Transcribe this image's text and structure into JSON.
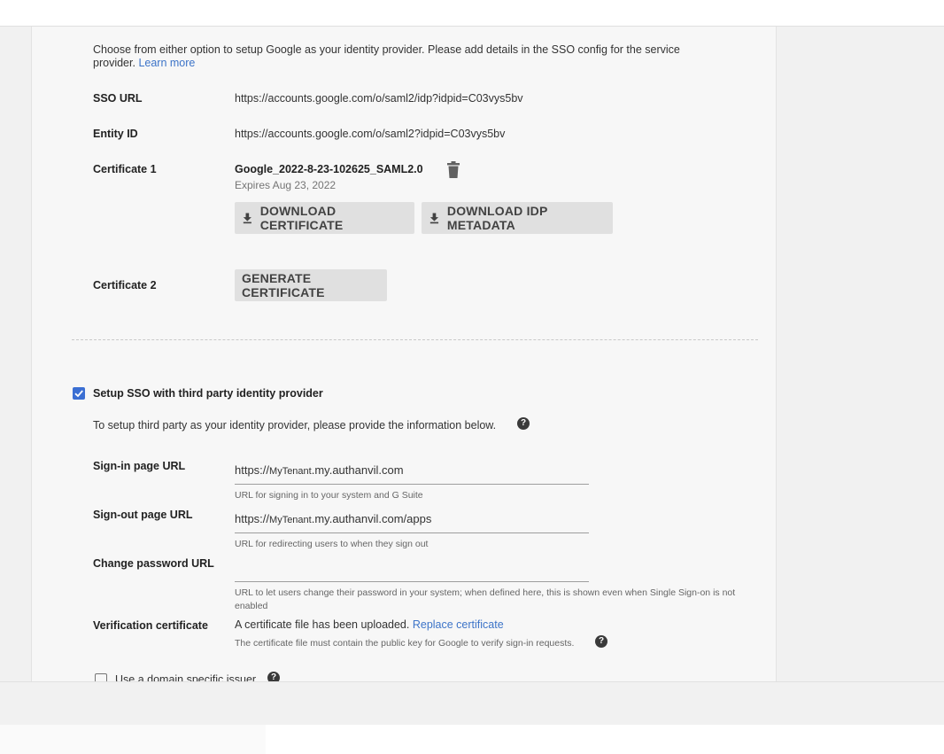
{
  "intro": {
    "text": "Choose from either option to setup Google as your identity provider. Please add details in the SSO config for the service provider.",
    "learn_more": "Learn more"
  },
  "sso_url": {
    "label": "SSO URL",
    "value": "https://accounts.google.com/o/saml2/idp?idpid=C03vys5bv"
  },
  "entity_id": {
    "label": "Entity ID",
    "value": "https://accounts.google.com/o/saml2?idpid=C03vys5bv"
  },
  "certificate1": {
    "label": "Certificate 1",
    "name": "Google_2022-8-23-102625_SAML2.0",
    "expires": "Expires Aug 23, 2022",
    "delete_icon": "trash-icon",
    "download_cert": "DOWNLOAD CERTIFICATE",
    "download_idp": "DOWNLOAD IDP METADATA",
    "download_icon": "download-icon"
  },
  "certificate2": {
    "label": "Certificate 2",
    "generate": "GENERATE CERTIFICATE"
  },
  "third_party": {
    "checkbox_label": "Setup SSO with third party identity provider",
    "checked": true,
    "description": "To setup third party as your identity provider, please provide the information below.",
    "sign_in": {
      "label": "Sign-in page URL",
      "prefix": "https://",
      "tenant": "MyTenant",
      "suffix": ".my.authanvil.com",
      "hint": "URL for signing in to your system and G Suite"
    },
    "sign_out": {
      "label": "Sign-out page URL",
      "prefix": "https://",
      "tenant": "MyTenant",
      "suffix": ".my.authanvil.com/apps",
      "hint": "URL for redirecting users to when they sign out"
    },
    "change_password": {
      "label": "Change password URL",
      "value": "",
      "hint": "URL to let users change their password in your system; when defined here, this is shown even when Single Sign-on is not enabled"
    },
    "verification": {
      "label": "Verification certificate",
      "status": "A certificate file has been uploaded.",
      "replace_link": "Replace certificate",
      "hint": "The certificate file must contain the public key for Google to verify sign-in requests."
    },
    "domain_issuer": {
      "label": "Use a domain specific issuer",
      "checked": false
    }
  },
  "colors": {
    "accent": "#3b6fd3",
    "link": "#3d74c8",
    "button_bg": "#e0e0e0"
  }
}
